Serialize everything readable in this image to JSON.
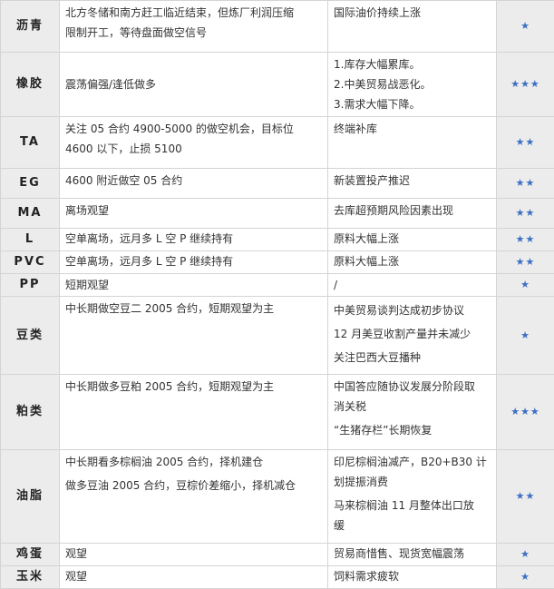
{
  "rows": [
    {
      "name": "沥青",
      "strategy": [
        "北方冬储和南方赶工临近结束，但炼厂利润压缩",
        "限制开工，等待盘面做空信号"
      ],
      "reason": [
        "国际油价持续上涨"
      ],
      "rating": "★"
    },
    {
      "name": "橡胶",
      "strategy": [
        "震荡偏强/逢低做多"
      ],
      "reason": [
        "1.库存大幅累库。",
        "2.中美贸易战恶化。",
        "3.需求大幅下降。"
      ],
      "rating": "★★★"
    },
    {
      "name": "TA",
      "strategy": [
        "关注 05 合约 4900-5000 的做空机会，目标位",
        "4600 以下，止损 5100"
      ],
      "reason": [
        "终端补库"
      ],
      "rating": "★★"
    },
    {
      "name": "EG",
      "strategy": [
        "4600 附近做空 05 合约"
      ],
      "reason": [
        "新装置投产推迟"
      ],
      "rating": "★★"
    },
    {
      "name": "MA",
      "strategy": [
        "离场观望"
      ],
      "reason": [
        "去库超预期风险因素出现"
      ],
      "rating": "★★"
    },
    {
      "name": "L",
      "strategy": [
        "空单离场，远月多 L 空 P 继续持有"
      ],
      "reason": [
        "原料大幅上涨"
      ],
      "rating": "★★"
    },
    {
      "name": "PVC",
      "strategy": [
        "空单离场，远月多 L 空 P 继续持有"
      ],
      "reason": [
        "原料大幅上涨"
      ],
      "rating": "★★"
    },
    {
      "name": "PP",
      "strategy": [
        "短期观望"
      ],
      "reason": [
        "/"
      ],
      "rating": "★"
    },
    {
      "name": "豆类",
      "strategy": [
        "中长期做空豆二 2005 合约，短期观望为主"
      ],
      "reason": [
        "中美贸易谈判达成初步协议",
        "12 月美豆收割产量并未减少",
        "关注巴西大豆播种"
      ],
      "rating": "★"
    },
    {
      "name": "粕类",
      "strategy": [
        "中长期做多豆粕 2005 合约，短期观望为主"
      ],
      "reason": [
        "中国答应随协议发展分阶段取",
        "消关税",
        "“生猪存栏”长期恢复"
      ],
      "rating": "★★★"
    },
    {
      "name": "油脂",
      "strategy": [
        "中长期看多棕榈油 2005 合约，择机建仓",
        "做多豆油 2005 合约，豆棕价差缩小，择机减仓"
      ],
      "reason": [
        "印尼棕榈油减产，B20+B30 计",
        "划提振消费",
        "马来棕榈油 11 月整体出口放",
        "缓"
      ],
      "rating": "★★"
    },
    {
      "name": "鸡蛋",
      "strategy": [
        "观望"
      ],
      "reason": [
        "贸易商惜售、现货宽幅震荡"
      ],
      "rating": "★"
    },
    {
      "name": "玉米",
      "strategy": [
        "观望"
      ],
      "reason": [
        "饲料需求疲软"
      ],
      "rating": "★"
    }
  ]
}
